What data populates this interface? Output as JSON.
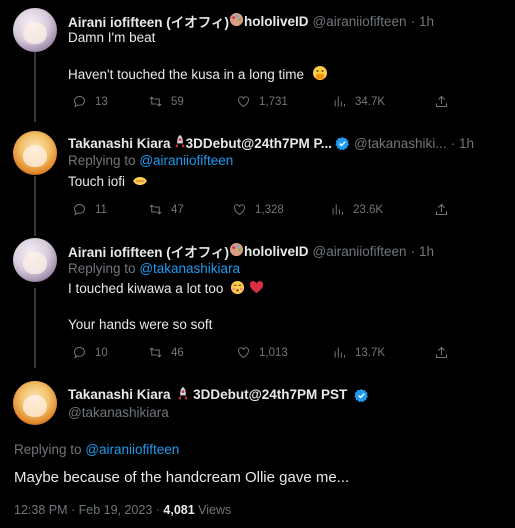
{
  "tweets": [
    {
      "name": "Airani iofifteen (イオフィ)",
      "name_suffix": "hololiveID",
      "handle": "@airaniiofifteen",
      "time": "1h",
      "lines": [
        "Damn I'm beat",
        "Haven't touched the kusa in a long time"
      ],
      "stats": {
        "replies": "13",
        "retweets": "59",
        "likes": "1,731",
        "views": "34.7K"
      }
    },
    {
      "name": "Takanashi Kiara",
      "name_suffix": "3DDebut@24th7PM P...",
      "handle": "@takanashiki...",
      "time": "1h",
      "replying_label": "Replying to",
      "replying_to": "@airaniiofifteen",
      "lines": [
        "Touch iofi"
      ],
      "stats": {
        "replies": "11",
        "retweets": "47",
        "likes": "1,328",
        "views": "23.6K"
      }
    },
    {
      "name": "Airani iofifteen (イオフィ)",
      "name_suffix": "hololiveID",
      "handle": "@airaniiofifteen",
      "time": "1h",
      "replying_label": "Replying to",
      "replying_to": "@takanashikiara",
      "lines": [
        "I touched kiwawa a lot too",
        "Your hands were so soft"
      ],
      "stats": {
        "replies": "10",
        "retweets": "46",
        "likes": "1,013",
        "views": "13.7K"
      }
    }
  ],
  "main_tweet": {
    "name": "Takanashi Kiara",
    "name_suffix": "3DDebut@24th7PM PST",
    "handle": "@takanashikiara",
    "replying_label": "Replying to",
    "replying_to": "@airaniiofifteen",
    "text": "Maybe because of the handcream Ollie gave me...",
    "timestamp": "12:38 PM · Feb 19, 2023 ·",
    "views_count": "4,081",
    "views_label": "Views"
  },
  "separator": "·",
  "more_label": "···",
  "colors": {
    "accent": "#1d9bf0",
    "muted": "#71767b",
    "text": "#e7e9ea",
    "background": "#000000"
  },
  "icons": [
    "reply-icon",
    "retweet-icon",
    "like-icon",
    "views-icon",
    "share-icon",
    "verified-icon",
    "more-icon"
  ]
}
